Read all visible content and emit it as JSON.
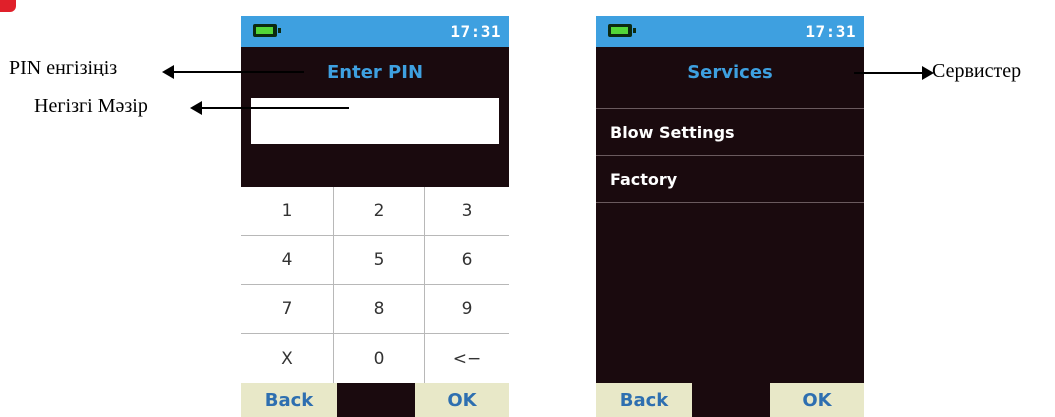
{
  "annotations": {
    "pin_prompt": "PIN енгізіңіз",
    "main_menu": "Негізгі Мәзір",
    "services": "Сервистер"
  },
  "left_screen": {
    "status": {
      "battery_icon": "battery-icon",
      "time": "17:31"
    },
    "title": "Enter PIN",
    "pin_value": "",
    "keypad": [
      "1",
      "2",
      "3",
      "4",
      "5",
      "6",
      "7",
      "8",
      "9",
      "X",
      "0",
      "<−"
    ],
    "softkeys": {
      "back": "Back",
      "ok": "OK"
    }
  },
  "right_screen": {
    "status": {
      "battery_icon": "battery-icon",
      "time": "17:31"
    },
    "title": "Services",
    "menu_items": [
      "Blow Settings",
      "Factory"
    ],
    "softkeys": {
      "back": "Back",
      "ok": "OK"
    }
  },
  "colors": {
    "status_bar": "#3ea0e0",
    "screen_bg": "#1a0a0e",
    "title": "#3ea0e0",
    "softkey_bg": "#e8e8c8",
    "softkey_text": "#2e6fb0",
    "corner_mark": "#e0202a"
  }
}
